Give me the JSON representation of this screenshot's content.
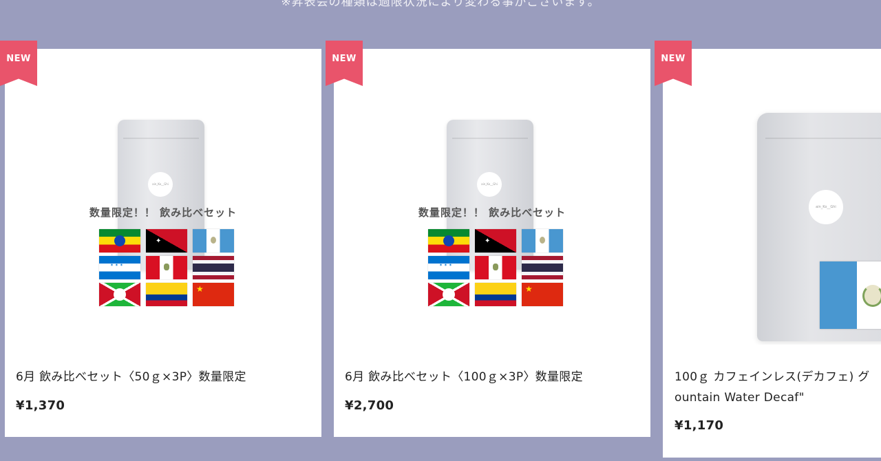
{
  "notice": "※昇表会の種類は過限状況により変わる事がございます。",
  "products": [
    {
      "badge": "NEW",
      "image_title": "数量限定！！ 飲み比べセット",
      "bag_label": "ain_Ko__Ghi",
      "flags": [
        "ethiopia-flag",
        "papua-new-guinea-flag",
        "guatemala-flag",
        "honduras-flag",
        "peru-flag",
        "thailand-flag",
        "burundi-flag",
        "colombia-flag",
        "china-flag"
      ],
      "name": "6月 飲み比べセット〈50ｇ×3P〉数量限定",
      "price": "¥1,370"
    },
    {
      "badge": "NEW",
      "image_title": "数量限定！！ 飲み比べセット",
      "bag_label": "ain_Ko__Ghi",
      "flags": [
        "ethiopia-flag",
        "papua-new-guinea-flag",
        "guatemala-flag",
        "honduras-flag",
        "peru-flag",
        "thailand-flag",
        "burundi-flag",
        "colombia-flag",
        "china-flag"
      ],
      "name": "6月 飲み比べセット〈100ｇ×3P〉数量限定",
      "price": "¥2,700"
    },
    {
      "badge": "NEW",
      "bag_label": "ain_Ko__Ghi",
      "flags": [
        "guatemala-flag"
      ],
      "name": "100ｇ カフェインレス(デカフェ) グ\nountain Water Decaf\"",
      "price": "¥1,170"
    }
  ],
  "colors": {
    "background": "#9a9dbe",
    "badge": "#e9546b",
    "card": "#ffffff"
  }
}
